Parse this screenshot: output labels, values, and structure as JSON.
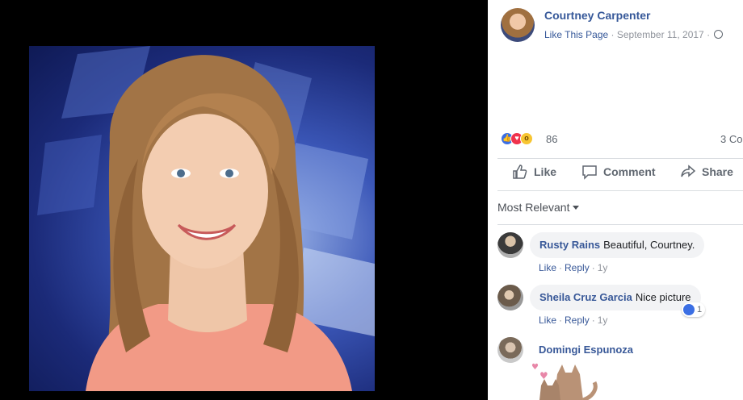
{
  "post": {
    "author": "Courtney Carpenter",
    "like_page": "Like This Page",
    "separator": "·",
    "date": "September 11, 2017",
    "privacy_icon": "globe-icon"
  },
  "reactions": {
    "icons": [
      "like-reaction-icon",
      "love-reaction-icon",
      "wow-reaction-icon"
    ],
    "count": "86",
    "comments_count": "3 Co"
  },
  "actions": {
    "like": "Like",
    "comment": "Comment",
    "share": "Share"
  },
  "sort_label": "Most Relevant",
  "comments": [
    {
      "name": "Rusty Rains",
      "text": "Beautiful, Courtney.",
      "like": "Like",
      "reply": "Reply",
      "time": "1y"
    },
    {
      "name": "Sheila Cruz Garcia",
      "text": "Nice picture",
      "like": "Like",
      "reply": "Reply",
      "time": "1y",
      "reaction_count": "1"
    },
    {
      "name": "Domingi Espunoza",
      "text": ""
    }
  ],
  "colors": {
    "link_blue": "#385898",
    "muted": "#90949c",
    "bubble_bg": "#f2f3f5"
  }
}
